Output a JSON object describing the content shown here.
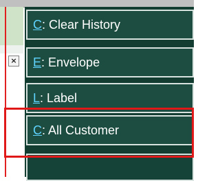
{
  "menu": {
    "items": [
      {
        "key": "C",
        "label": ": Clear History"
      },
      {
        "key": "E",
        "label": ": Envelope"
      },
      {
        "key": "L",
        "label": ": Label"
      },
      {
        "key": "C",
        "label": ": All Customer"
      }
    ]
  },
  "left_pane": {
    "close_glyph": "×"
  },
  "colors": {
    "menu_bg": "#143d32",
    "item_bg": "#1d4d40",
    "hotkey": "#5fd3ff",
    "highlight": "#e01818"
  }
}
